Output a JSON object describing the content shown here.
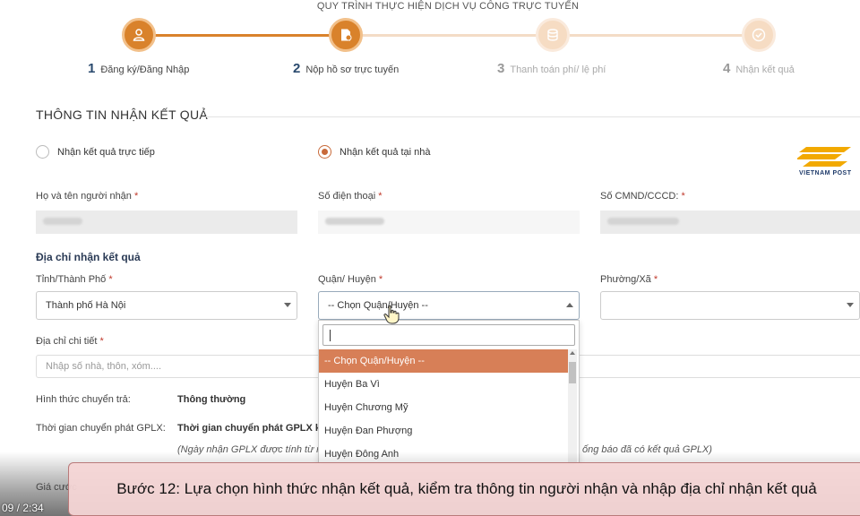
{
  "steps": {
    "title": "QUY TRÌNH THỰC HIỆN DỊCH VỤ CÔNG TRỰC TUYẾN",
    "items": [
      {
        "num": "1",
        "label": "Đăng ký/Đăng Nhập",
        "state": "done"
      },
      {
        "num": "2",
        "label": "Nộp hồ sơ trực tuyến",
        "state": "active"
      },
      {
        "num": "3",
        "label": "Thanh toán phí/ lệ phí",
        "state": "pending"
      },
      {
        "num": "4",
        "label": "Nhận kết quả",
        "state": "pending"
      }
    ]
  },
  "section_title": "THÔNG TIN NHẬN KẾT QUẢ",
  "receive_options": {
    "direct": "Nhận kết quả trực tiếp",
    "home": "Nhận kết quả tại nhà",
    "selected": "home"
  },
  "logo_text": "VIETNAM POST",
  "recipient": {
    "name_label": "Họ và tên người nhận",
    "phone_label": "Số điện thoại",
    "id_label": "Số CMND/CCCD:",
    "required_mark": "*"
  },
  "address": {
    "heading": "Địa chỉ nhận kết quả",
    "province_label": "Tỉnh/Thành Phố",
    "province_value": "Thành phố Hà Nội",
    "district_label": "Quận/ Huyện",
    "district_value": "-- Chọn Quận/Huyện --",
    "ward_label": "Phường/Xã",
    "ward_value": "",
    "detail_label": "Địa chỉ chi tiết",
    "detail_placeholder": "Nhập số nhà, thôn, xóm...."
  },
  "district_dropdown": {
    "options": [
      "-- Chọn Quận/Huyện --",
      "Huyện Ba Vì",
      "Huyện Chương Mỹ",
      "Huyện Đan Phượng",
      "Huyện Đông Anh"
    ],
    "selected_index": 0
  },
  "delivery": {
    "method_label": "Hình thức chuyển trả:",
    "method_value": "Thông thường",
    "time_label": "Thời gian chuyển phát GPLX:",
    "time_value": "Thời gian chuyển phát GPLX kể",
    "note_left": "(Ngày nhận GPLX được tính từ n",
    "note_right": "ống báo đã có kết quả GPLX)",
    "fee_label_partial": "Giá cước"
  },
  "video": {
    "time": "09 / 2:34",
    "caption": "Bước 12: Lựa chọn hình thức nhận kết quả, kiểm tra thông tin người nhận và nhập địa chỉ nhận kết quả"
  },
  "colors": {
    "accent": "#d9822b",
    "accent_light": "#f6dcc3",
    "selected_option": "#d77f57",
    "caption_bg": "#f5d6d6"
  }
}
